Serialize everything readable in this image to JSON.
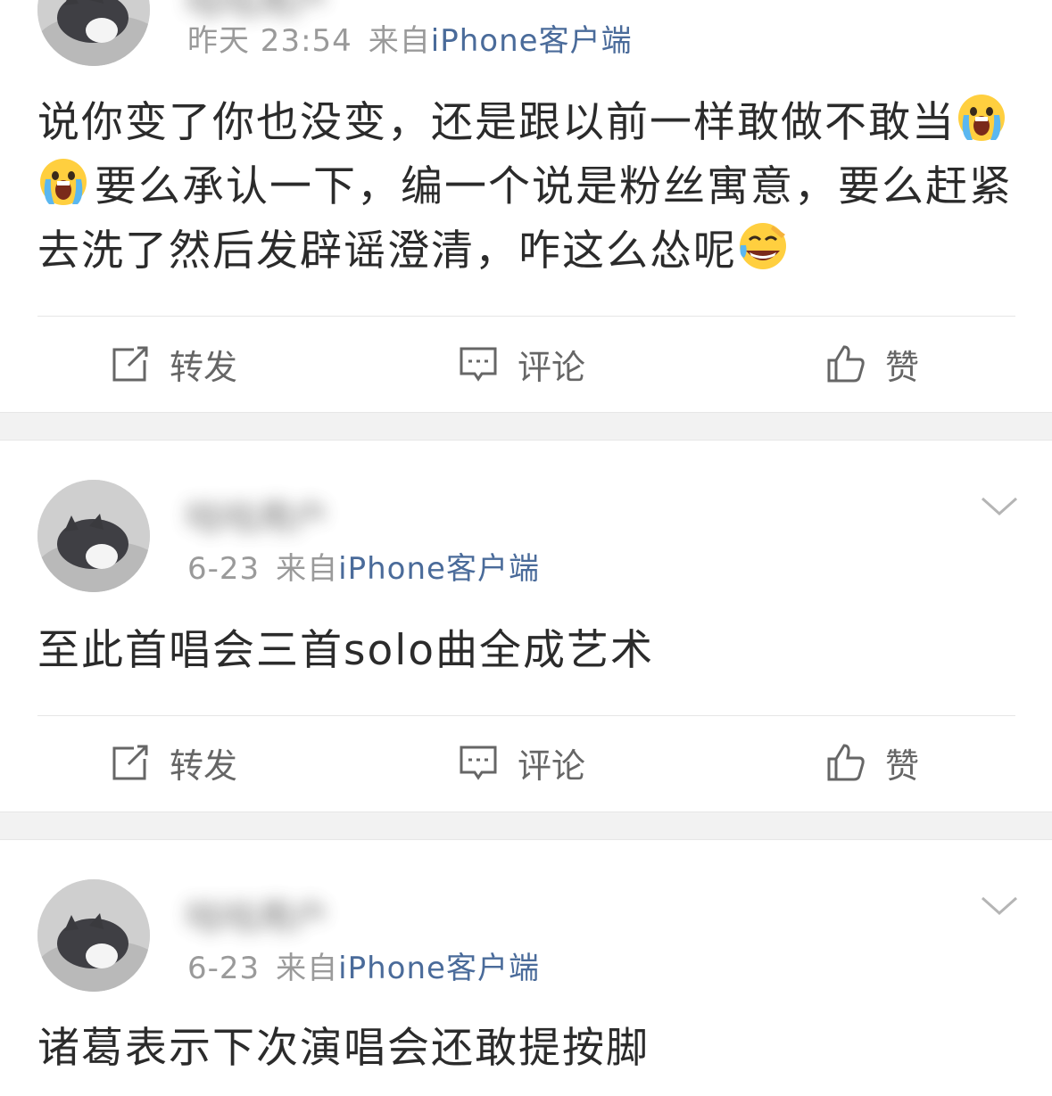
{
  "posts": [
    {
      "username": "咕咕用户",
      "time": "昨天 23:54",
      "from_prefix": "来自",
      "source": "iPhone客户端",
      "text_segments": [
        {
          "type": "text",
          "value": "说你变了你也没变，还是跟以前一样敢做不敢当"
        },
        {
          "type": "emoji",
          "name": "crying-emoji"
        },
        {
          "type": "emoji",
          "name": "crying-emoji"
        },
        {
          "type": "text",
          "value": "要么承认一下，编一个说是粉丝寓意，要么赶紧去洗了然后发辟谣澄清，咋这么怂呢"
        },
        {
          "type": "emoji",
          "name": "laughing-cry-emoji"
        }
      ],
      "actions": {
        "repost": "转发",
        "comment": "评论",
        "like": "赞"
      }
    },
    {
      "username": "咕咕用户",
      "time": "6-23",
      "from_prefix": "来自",
      "source": "iPhone客户端",
      "text": "至此首唱会三首solo曲全成艺术",
      "actions": {
        "repost": "转发",
        "comment": "评论",
        "like": "赞"
      }
    },
    {
      "username": "咕咕用户",
      "time": "6-23",
      "from_prefix": "来自",
      "source": "iPhone客户端",
      "text": "诸葛表示下次演唱会还敢提按脚"
    }
  ],
  "colors": {
    "text": "#2b2b2b",
    "meta": "#9a9a9a",
    "source_link": "#4a6b9a",
    "separator": "#f2f2f2"
  }
}
